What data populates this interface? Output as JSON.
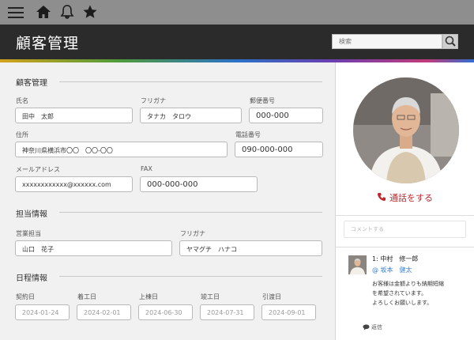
{
  "topbar": {
    "icons": [
      "hamburger-menu-icon",
      "home-icon",
      "bell-icon",
      "star-icon"
    ]
  },
  "header": {
    "title": "顧客管理",
    "search_placeholder": "検索"
  },
  "customer": {
    "section_title": "顧客管理",
    "name_label": "氏名",
    "name_value": "田中　太郎",
    "furigana_label": "フリガナ",
    "furigana_value": "タナカ　タロウ",
    "postal_label": "郵便番号",
    "postal_value": "000-000",
    "address_label": "住所",
    "address_value": "神奈川県横浜市〇〇　〇〇-〇〇",
    "phone_label": "電話番号",
    "phone_value": "090-000-000",
    "email_label": "メールアドレス",
    "email_value": "xxxxxxxxxxxx@xxxxxx.com",
    "fax_label": "FAX",
    "fax_value": "000-000-000"
  },
  "staff": {
    "section_title": "担当情報",
    "sales_label": "営業担当",
    "sales_value": "山口　花子",
    "furigana_label": "フリガナ",
    "furigana_value": "ヤマグチ　ハナコ"
  },
  "schedule": {
    "section_title": "日程情報",
    "items": [
      {
        "label": "契約日",
        "value": "2024-01-24"
      },
      {
        "label": "着工日",
        "value": "2024-02-01"
      },
      {
        "label": "上棟日",
        "value": "2024-06-30"
      },
      {
        "label": "竣工日",
        "value": "2024-07-31"
      },
      {
        "label": "引渡日",
        "value": "2024-09-01"
      }
    ]
  },
  "side": {
    "call_label": "通話をする",
    "comment_placeholder": "コメントする",
    "comment": {
      "author": "1: 中村　修一郎",
      "mention": "@ 坂本　健太",
      "lines": [
        "お客様は金額よりも納期短縮",
        "を希望されています。",
        "よろしくお願いします。"
      ],
      "reply_label": "返信"
    }
  },
  "colors": {
    "header_bg": "#2b2b2b",
    "topbar_bg": "#8e8e8e",
    "call_red": "#c0262b",
    "mention_blue": "#3c7fd1"
  }
}
